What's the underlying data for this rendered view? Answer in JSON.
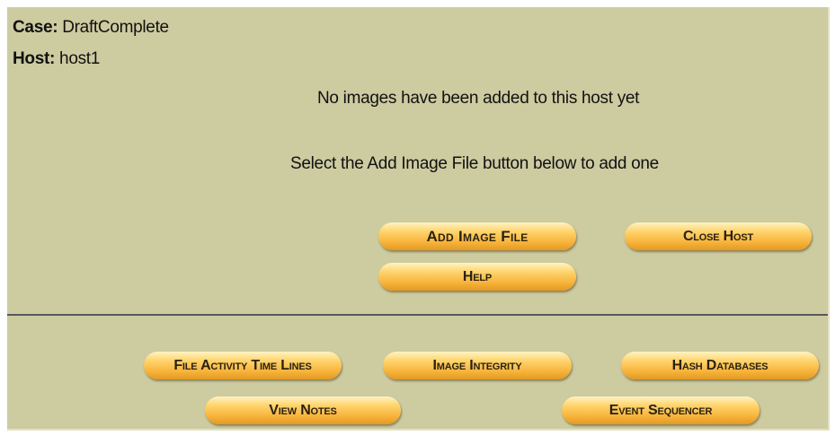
{
  "case": {
    "label": "Case:",
    "value": "DraftComplete"
  },
  "host": {
    "label": "Host:",
    "value": "host1"
  },
  "messages": {
    "no_images": "No images have been added to this host yet",
    "instruction": "Select the Add Image File button below to add one"
  },
  "host_actions": {
    "add_image": "Add Image File",
    "close_host": "Close Host",
    "help": "Help"
  },
  "tools": {
    "file_activity": "File Activity Time Lines",
    "image_integrity": "Image Integrity",
    "hash_databases": "Hash Databases",
    "view_notes": "View Notes",
    "event_sequencer": "Event Sequencer"
  },
  "colors": {
    "panel_background": "#cdcba0",
    "button_gold": "#f8b43c",
    "divider": "#555a5a"
  }
}
